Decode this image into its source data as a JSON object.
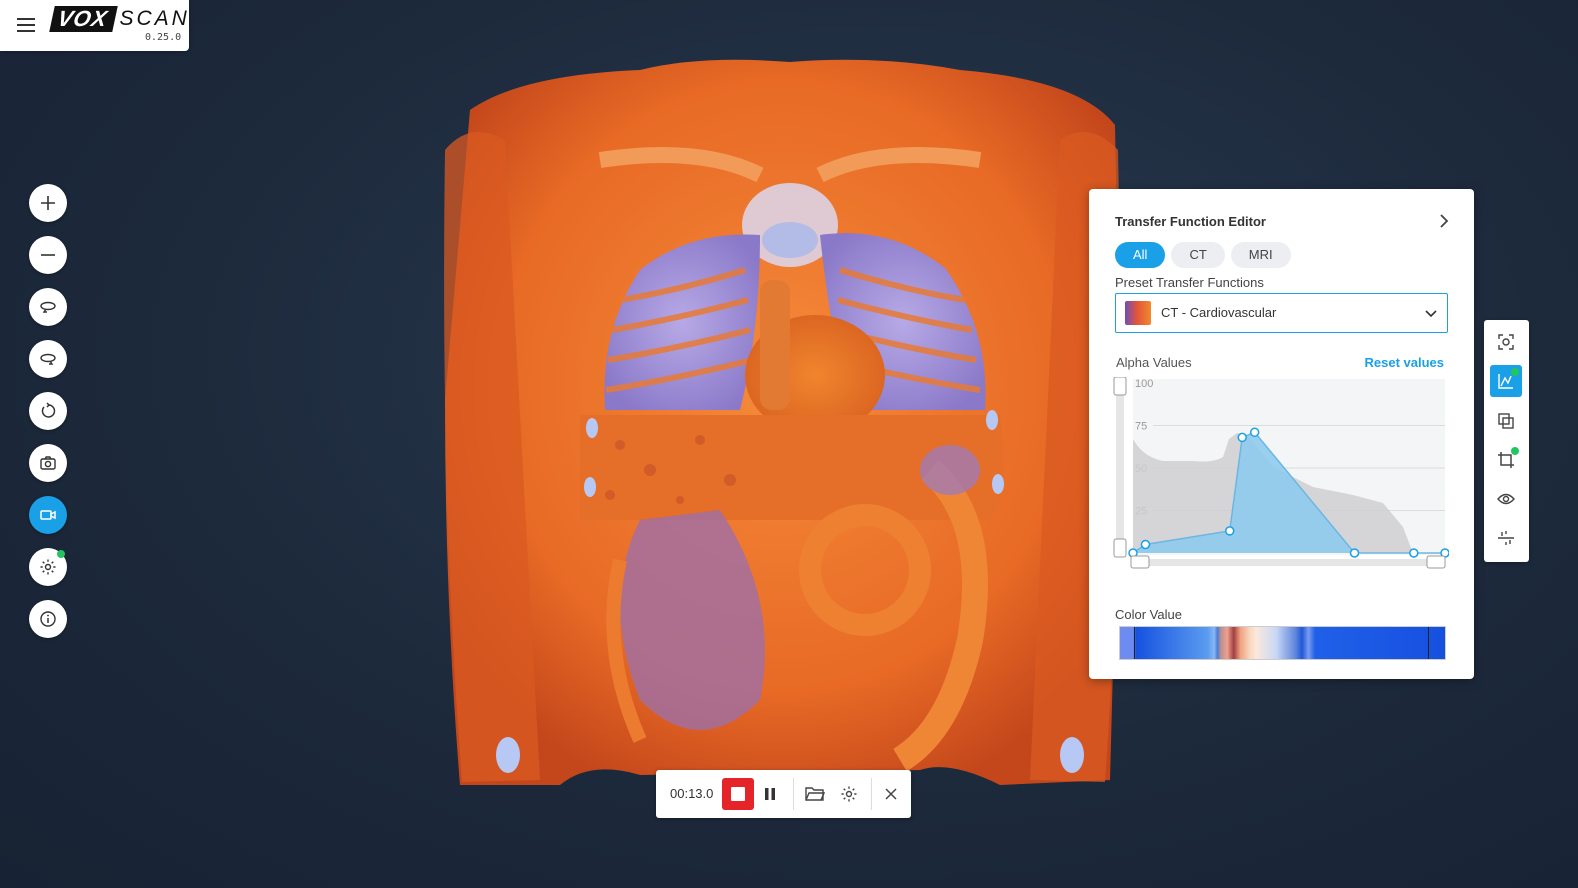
{
  "app": {
    "brand_left": "VOX",
    "brand_right": "SCAN",
    "version": "0.25.0"
  },
  "left_toolbar": {
    "buttons": [
      {
        "name": "zoom-in",
        "icon": "plus-icon"
      },
      {
        "name": "zoom-out",
        "icon": "minus-icon"
      },
      {
        "name": "rotate-left",
        "icon": "rotate-left-icon"
      },
      {
        "name": "rotate-right",
        "icon": "rotate-right-icon"
      },
      {
        "name": "reset-view",
        "icon": "reset-icon"
      },
      {
        "name": "screenshot",
        "icon": "camera-icon"
      },
      {
        "name": "record-video",
        "icon": "video-camera-icon",
        "active": true
      },
      {
        "name": "settings",
        "icon": "gear-icon"
      },
      {
        "name": "info",
        "icon": "info-icon"
      }
    ]
  },
  "transfer_function": {
    "title": "Transfer Function Editor",
    "tabs": [
      {
        "label": "All",
        "active": true
      },
      {
        "label": "CT",
        "active": false
      },
      {
        "label": "MRI",
        "active": false
      }
    ],
    "preset_label": "Preset Transfer Functions",
    "preset_selected": "CT - Cardiovascular",
    "alpha_label": "Alpha Values",
    "reset_label": "Reset values",
    "alpha_ticks": [
      "100",
      "75",
      "50",
      "25"
    ],
    "alpha_points": [
      {
        "x": 0.0,
        "y": 0
      },
      {
        "x": 0.04,
        "y": 5
      },
      {
        "x": 0.31,
        "y": 13
      },
      {
        "x": 0.35,
        "y": 68
      },
      {
        "x": 0.39,
        "y": 71
      },
      {
        "x": 0.71,
        "y": 0
      },
      {
        "x": 0.9,
        "y": 0
      },
      {
        "x": 1.0,
        "y": 0
      }
    ],
    "color_label": "Color Value",
    "accent_color": "#1aa0e6"
  },
  "right_toolbar": {
    "buttons": [
      {
        "name": "focus",
        "icon": "focus-target-icon"
      },
      {
        "name": "transfer-function",
        "icon": "chart-curve-icon",
        "active": true
      },
      {
        "name": "layers",
        "icon": "layers-icon"
      },
      {
        "name": "crop",
        "icon": "crop-icon"
      },
      {
        "name": "visibility",
        "icon": "eye-icon"
      },
      {
        "name": "clip",
        "icon": "clip-icon"
      }
    ]
  },
  "recording": {
    "time": "00:13.0",
    "stop_color": "#e5242a"
  }
}
